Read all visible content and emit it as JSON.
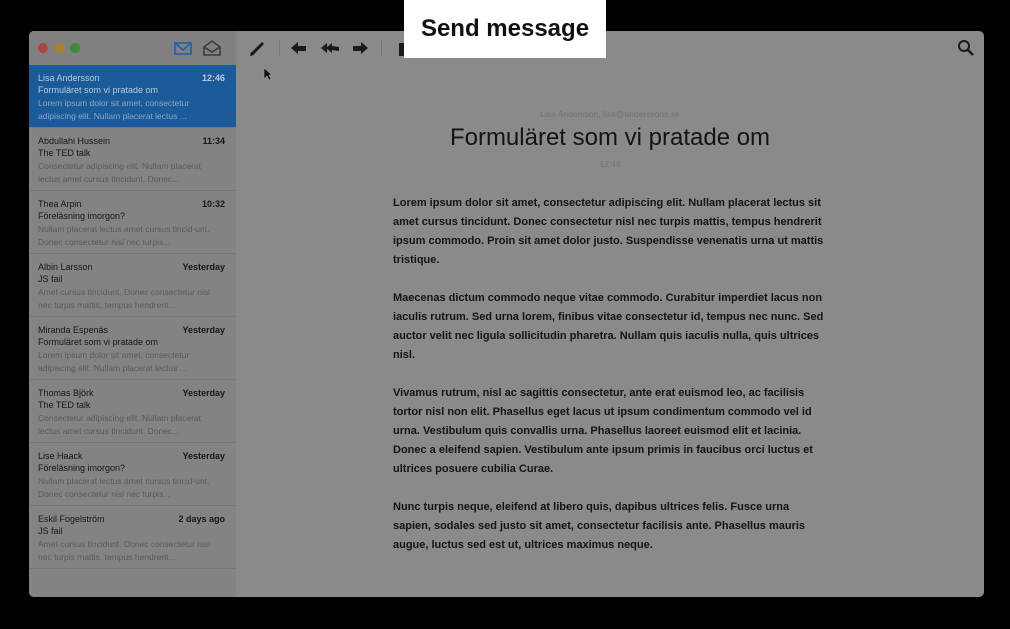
{
  "banner": {
    "text": "Send message"
  },
  "sidebar": {
    "messages": [
      {
        "sender": "Lisa Andersson",
        "time": "12:46",
        "subject": "Formuläret som vi pratade om",
        "preview": "Lorem ipsum dolor sit amet, consectetur adipiscing elit. Nullam placerat lectus ..."
      },
      {
        "sender": "Abdullahi Hussein",
        "time": "11:34",
        "subject": "The TED talk",
        "preview": "Consectetur adipiscing elit. Nullam placerat lectus amet cursus tincidunt. Donec..."
      },
      {
        "sender": "Thea Arpin",
        "time": "10:32",
        "subject": "Föreläsning imorgon?",
        "preview": "Nullam placerat lectus amet cursus tincid-unt. Donec consectetur nisl nec turpis..."
      },
      {
        "sender": "Albin Larsson",
        "time": "Yesterday",
        "subject": "JS fail",
        "preview": "Amet cursus tincidunt. Donec consectetur nisl nec turpis mattis, tempus hendrerit..."
      },
      {
        "sender": "Miranda Espenäs",
        "time": "Yesterday",
        "subject": "Formuläret som vi pratade om",
        "preview": "Lorem ipsum dolor sit amet, consectetur adipiscing elit. Nullam placerat lectus ..."
      },
      {
        "sender": "Thomas Björk",
        "time": "Yesterday",
        "subject": "The TED talk",
        "preview": "Consectetur adipiscing elit. Nullam placerat lectus amet cursus tincidunt. Donec..."
      },
      {
        "sender": "Lise Haack",
        "time": "Yesterday",
        "subject": "Föreläsning imorgon?",
        "preview": "Nullam placerat lectus amet cursus tincid-unt. Donec consectetur nisl nec turpis..."
      },
      {
        "sender": "Eskil Fogelström",
        "time": "2 days ago",
        "subject": "JS fail",
        "preview": "Amet cursus tincidunt. Donec consectetur nisl nec turpis mattis, tempus hendrerit..."
      }
    ]
  },
  "mail": {
    "from": "Lisa Andersson, lisa@anderssons.se",
    "title": "Formuläret som vi pratade om",
    "time": "12:46",
    "paragraphs": [
      "Lorem ipsum dolor sit amet, consectetur adipiscing elit. Nullam placerat lectus sit amet cursus tincidunt. Donec consectetur nisl nec turpis mattis, tempus hendrerit ipsum commodo. Proin sit amet dolor justo. Suspendisse venenatis urna ut mattis tristique.",
      "Maecenas dictum commodo neque vitae commodo. Curabitur imperdiet lacus non iaculis rutrum. Sed urna lorem, finibus vitae consectetur id, tempus nec nunc. Sed auctor velit nec ligula sollicitudin pharetra. Nullam quis iaculis nulla, quis ultrices nisl.",
      "Vivamus rutrum, nisl ac sagittis consectetur, ante erat euismod leo, ac facilisis tortor nisl non elit. Phasellus eget lacus ut ipsum condimentum commodo vel id urna. Vestibulum quis convallis urna. Phasellus laoreet euismod elit et lacinia. Donec a eleifend sapien. Vestibulum ante ipsum primis in faucibus orci luctus et ultrices posuere cubilia Curae.",
      "Nunc turpis neque, eleifend at libero quis, dapibus ultrices felis. Fusce urna sapien, sodales sed justo sit amet, consectetur facilisis ante. Phasellus mauris augue, luctus sed est ut, ultrices maximus neque."
    ]
  },
  "icons": {
    "inbox": "inbox-icon",
    "archive": "archive-icon",
    "compose": "compose-icon",
    "reply": "reply-icon",
    "reply_all": "reply-all-icon",
    "forward": "forward-icon",
    "trash": "trash-icon",
    "search": "search-icon"
  },
  "colors": {
    "selected_bg": "#1b5b9a",
    "accent": "#1e6fd0"
  }
}
